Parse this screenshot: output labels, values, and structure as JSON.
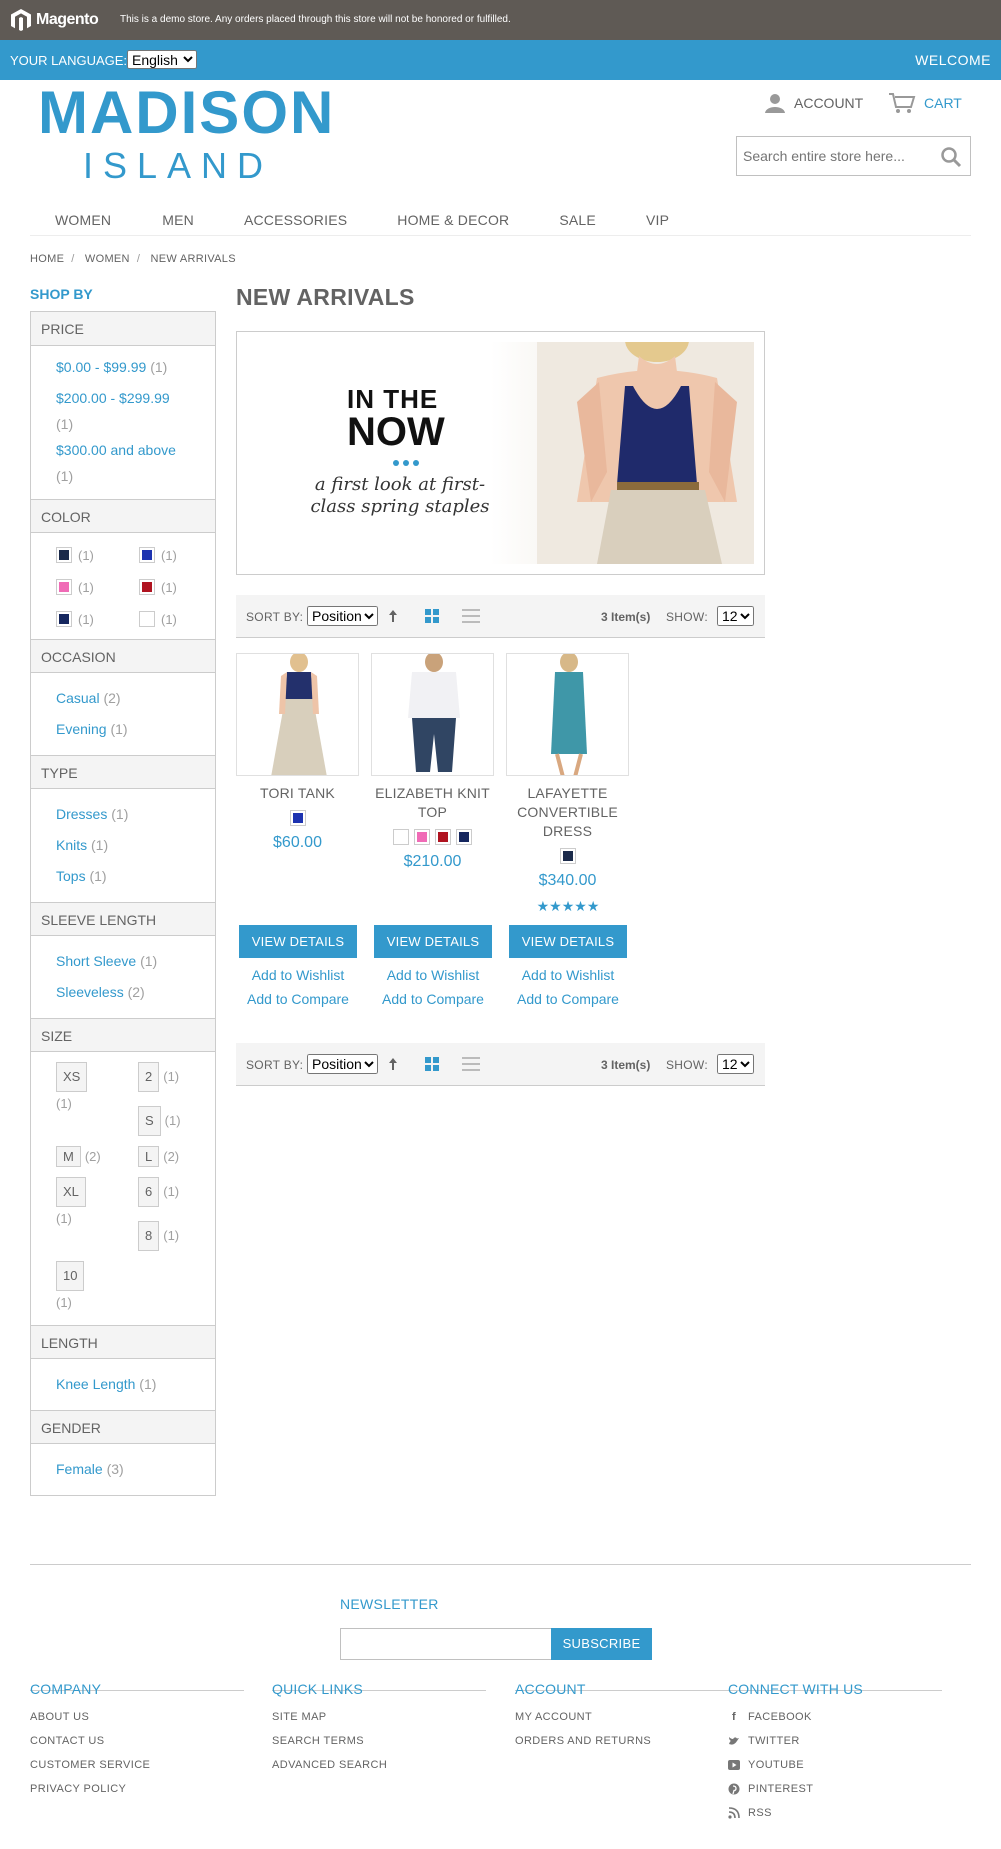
{
  "demo": {
    "brand": "Magento",
    "notice": "This is a demo store. Any orders placed through this store will not be honored or fulfilled."
  },
  "langbar": {
    "label": "YOUR LANGUAGE:",
    "language": "English",
    "welcome": "WELCOME"
  },
  "logo": {
    "line1": "MADISON",
    "line2": "ISLAND"
  },
  "header": {
    "account": "ACCOUNT",
    "cart": "CART",
    "search_placeholder": "Search entire store here..."
  },
  "nav": [
    "WOMEN",
    "MEN",
    "ACCESSORIES",
    "HOME & DECOR",
    "SALE",
    "VIP"
  ],
  "breadcrumb": [
    "HOME",
    "WOMEN",
    "NEW ARRIVALS"
  ],
  "sidebar": {
    "title": "SHOP BY",
    "price": {
      "title": "PRICE",
      "items": [
        {
          "label": "$0.00 - $99.99",
          "count": "(1)"
        },
        {
          "label": "$200.00 - $299.99",
          "count": "(1)"
        },
        {
          "label": "$300.00 and above",
          "count": "(1)"
        }
      ]
    },
    "color": {
      "title": "COLOR",
      "items": [
        {
          "color": "#1b2a4a",
          "count": "(1)"
        },
        {
          "color": "#1d33b0",
          "count": "(1)"
        },
        {
          "color": "#f06bb6",
          "count": "(1)"
        },
        {
          "color": "#b01320",
          "count": "(1)"
        },
        {
          "color": "#15265e",
          "count": "(1)"
        },
        {
          "color": "#ffffff",
          "count": "(1)"
        }
      ]
    },
    "occasion": {
      "title": "OCCASION",
      "items": [
        {
          "label": "Casual",
          "count": "(2)"
        },
        {
          "label": "Evening",
          "count": "(1)"
        }
      ]
    },
    "type": {
      "title": "TYPE",
      "items": [
        {
          "label": "Dresses",
          "count": "(1)"
        },
        {
          "label": "Knits",
          "count": "(1)"
        },
        {
          "label": "Tops",
          "count": "(1)"
        }
      ]
    },
    "sleeve": {
      "title": "SLEEVE LENGTH",
      "items": [
        {
          "label": "Short Sleeve",
          "count": "(1)"
        },
        {
          "label": "Sleeveless",
          "count": "(2)"
        }
      ]
    },
    "size": {
      "title": "SIZE",
      "items": [
        {
          "label": "XS",
          "count": "(1)"
        },
        {
          "label": "2",
          "count": "(1)"
        },
        {
          "label": "S",
          "count": "(1)"
        },
        {
          "label": "M",
          "count": "(2)"
        },
        {
          "label": "L",
          "count": "(2)"
        },
        {
          "label": "XL",
          "count": "(1)"
        },
        {
          "label": "6",
          "count": "(1)"
        },
        {
          "label": "8",
          "count": "(1)"
        },
        {
          "label": "10",
          "count": "(1)"
        }
      ]
    },
    "length": {
      "title": "LENGTH",
      "items": [
        {
          "label": "Knee Length",
          "count": "(1)"
        }
      ]
    },
    "gender": {
      "title": "GENDER",
      "items": [
        {
          "label": "Female",
          "count": "(3)"
        }
      ]
    }
  },
  "page_title": "NEW ARRIVALS",
  "banner": {
    "line1": "IN THE",
    "line2": "NOW",
    "tagline": "a first look at first-class spring staples"
  },
  "toolbar": {
    "sort_label": "SORT BY:",
    "sort_value": "Position",
    "count": "3 Item(s)",
    "show_label": "SHOW:",
    "show_value": "12"
  },
  "products": [
    {
      "name": "TORI TANK",
      "price": "$60.00",
      "swatches": [
        "#1d33b0"
      ]
    },
    {
      "name": "ELIZABETH KNIT TOP",
      "price": "$210.00",
      "swatches": [
        "#ffffff",
        "#f06bb6",
        "#b01320",
        "#15265e"
      ]
    },
    {
      "name": "LAFAYETTE CONVERTIBLE DRESS",
      "price": "$340.00",
      "swatches": [
        "#1b2a4a"
      ],
      "rating": 5
    }
  ],
  "product_actions": {
    "view": "VIEW DETAILS",
    "wishlist": "Add to Wishlist",
    "compare": "Add to Compare"
  },
  "newsletter": {
    "title": "NEWSLETTER",
    "button": "SUBSCRIBE"
  },
  "footer": {
    "company": {
      "title": "COMPANY",
      "links": [
        "ABOUT US",
        "CONTACT US",
        "CUSTOMER SERVICE",
        "PRIVACY POLICY"
      ]
    },
    "quick": {
      "title": "QUICK LINKS",
      "links": [
        "SITE MAP",
        "SEARCH TERMS",
        "ADVANCED SEARCH"
      ]
    },
    "account": {
      "title": "ACCOUNT",
      "links": [
        "MY ACCOUNT",
        "ORDERS AND RETURNS"
      ]
    },
    "connect": {
      "title": "CONNECT WITH US",
      "links": [
        "FACEBOOK",
        "TWITTER",
        "YOUTUBE",
        "PINTEREST",
        "RSS"
      ]
    }
  }
}
